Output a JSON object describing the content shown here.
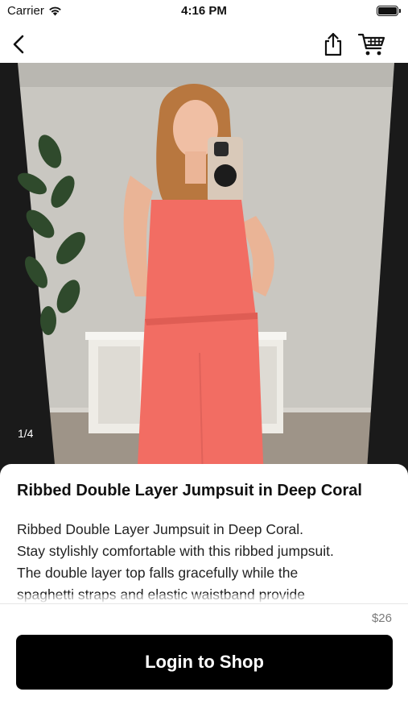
{
  "status_bar": {
    "carrier": "Carrier",
    "time": "4:16 PM",
    "icons": [
      "wifi-icon",
      "battery-icon"
    ]
  },
  "nav": {
    "icons": [
      "chevron-left-icon",
      "share-icon",
      "cart-icon"
    ]
  },
  "gallery": {
    "counter": "1/4",
    "current_index": 1,
    "total": 4
  },
  "product": {
    "title": "Ribbed Double Layer Jumpsuit in Deep Coral",
    "description_lines": [
      "Ribbed Double Layer Jumpsuit in Deep Coral.",
      "Stay stylishly comfortable with this ribbed jumpsuit.",
      "The double layer top falls gracefully while the",
      "spaghetti straps and elastic waistband provide"
    ],
    "price": "$26"
  },
  "actions": {
    "login_label": "Login to Shop"
  },
  "colors": {
    "primary_button": "#000000",
    "jumpsuit_coral": "#f26d63",
    "price_text": "#7a7a7a"
  }
}
